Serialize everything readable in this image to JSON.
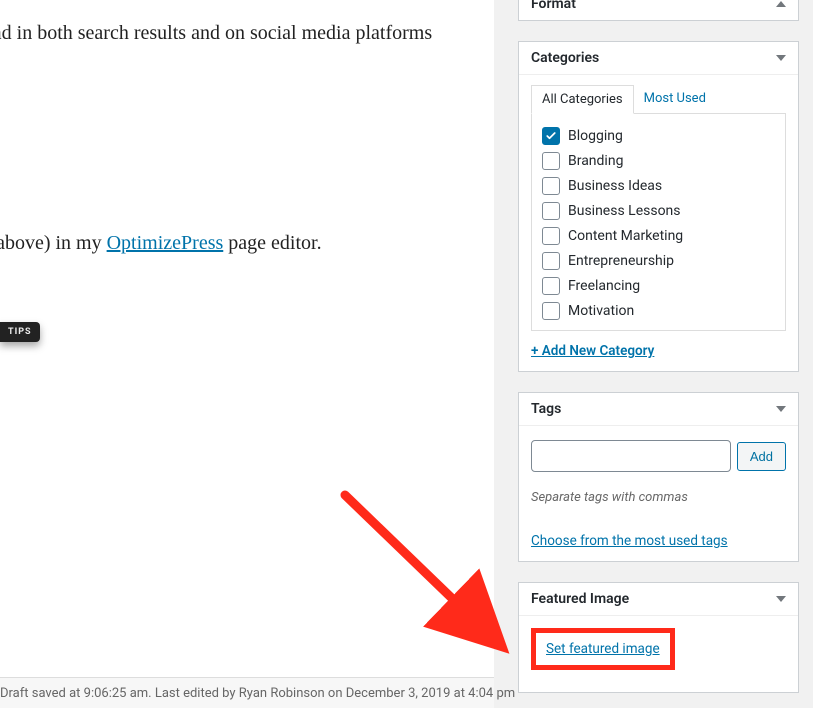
{
  "editor": {
    "line1_prefix": "osts (and in both search results and on social media platforms",
    "line2_prefix": "nere (above) in my ",
    "link_text": "OptimizePress",
    "line2_suffix": " page editor.",
    "tips_label": "TIPS",
    "footer_text": "Draft saved at 9:06:25 am. Last edited by Ryan Robinson on December 3, 2019 at 4:04 pm"
  },
  "sidebar": {
    "format": {
      "title": "Format"
    },
    "categories": {
      "title": "Categories",
      "tabs": {
        "all": "All Categories",
        "most": "Most Used"
      },
      "items": [
        {
          "label": "Blogging",
          "checked": true
        },
        {
          "label": "Branding",
          "checked": false
        },
        {
          "label": "Business Ideas",
          "checked": false
        },
        {
          "label": "Business Lessons",
          "checked": false
        },
        {
          "label": "Content Marketing",
          "checked": false
        },
        {
          "label": "Entrepreneurship",
          "checked": false
        },
        {
          "label": "Freelancing",
          "checked": false
        },
        {
          "label": "Motivation",
          "checked": false
        }
      ],
      "add_new": "+ Add New Category"
    },
    "tags": {
      "title": "Tags",
      "add_btn": "Add",
      "hint": "Separate tags with commas",
      "choose": "Choose from the most used tags"
    },
    "featured": {
      "title": "Featured Image",
      "set_link": "Set featured image"
    }
  },
  "colors": {
    "accent": "#0073aa",
    "highlight": "#ff2a1a"
  }
}
